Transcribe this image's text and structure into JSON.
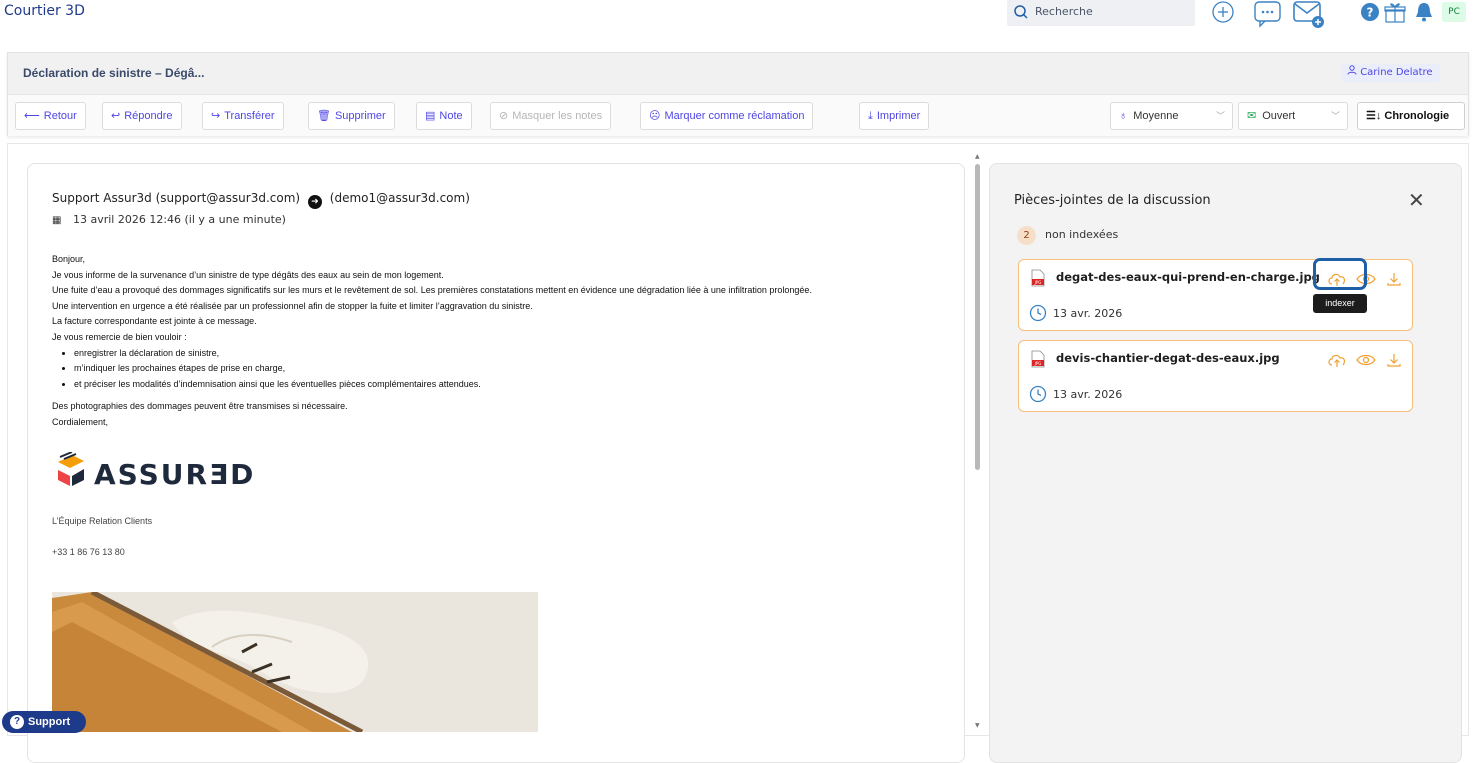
{
  "app": {
    "title": "Courtier 3D"
  },
  "topbar": {
    "search_placeholder": "Recherche",
    "avatar_initials": "PC",
    "icons": [
      "search-icon",
      "add-icon",
      "chat-icon",
      "new-mail-icon",
      "help-icon",
      "gift-icon",
      "bell-icon"
    ]
  },
  "ticket": {
    "title": "Déclaration de sinistre – Dégâ...",
    "assignee": "Carine Delatre"
  },
  "toolbar": {
    "back": "Retour",
    "reply": "Répondre",
    "forward": "Transférer",
    "delete": "Supprimer",
    "note": "Note",
    "hide_notes": "Masquer les notes",
    "mark_claim": "Marquer comme réclamation",
    "print": "Imprimer",
    "priority": "Moyenne",
    "status": "Ouvert",
    "timeline": "Chronologie"
  },
  "email": {
    "sender": "Support Assur3d (support@assur3d.com)",
    "recipient": "(demo1@assur3d.com)",
    "date": "13 avril 2026 12:46 (il y a une minute)",
    "greeting": "Bonjour,",
    "paragraphs": [
      "Je vous informe de la survenance d’un sinistre de type dégâts des eaux au sein de mon logement.",
      "Une fuite d’eau a provoqué des dommages significatifs sur les murs et le revêtement de sol. Les premières constatations mettent en évidence une dégradation liée à une infiltration prolongée.",
      "Une intervention en urgence a été réalisée par un professionnel afin de stopper la fuite et limiter l’aggravation du sinistre.",
      "La facture correspondante est jointe à ce message.",
      "Je vous remercie de bien vouloir :"
    ],
    "bullets": [
      "enregistrer la déclaration de sinistre,",
      "m’indiquer les prochaines étapes de prise en charge,",
      "et préciser les modalités d’indemnisation ainsi que les éventuelles pièces complémentaires attendues."
    ],
    "photos_note": "Des photographies des dommages peuvent être transmises si nécessaire.",
    "closing": "Cordialement,",
    "logo_text": "ASSURƎD",
    "team": "L’Équipe Relation Clients",
    "phone": "+33 1 86 76 13 80"
  },
  "attachments_panel": {
    "title": "Pièces-jointes de la discussion",
    "count": "2",
    "count_label": "non indexées",
    "items": [
      {
        "name": "degat-des-eaux-qui-prend-en-charge.jpg",
        "date": "13 avr. 2026"
      },
      {
        "name": "devis-chantier-degat-des-eaux.jpg",
        "date": "13 avr. 2026"
      }
    ],
    "tooltip": "indexer"
  },
  "support": {
    "label": "Support"
  },
  "colors": {
    "accent": "#4f46e5",
    "brand_dark": "#1e3a8a",
    "attachment_border": "#f5c07a",
    "attachment_icon": "#f0a030"
  }
}
